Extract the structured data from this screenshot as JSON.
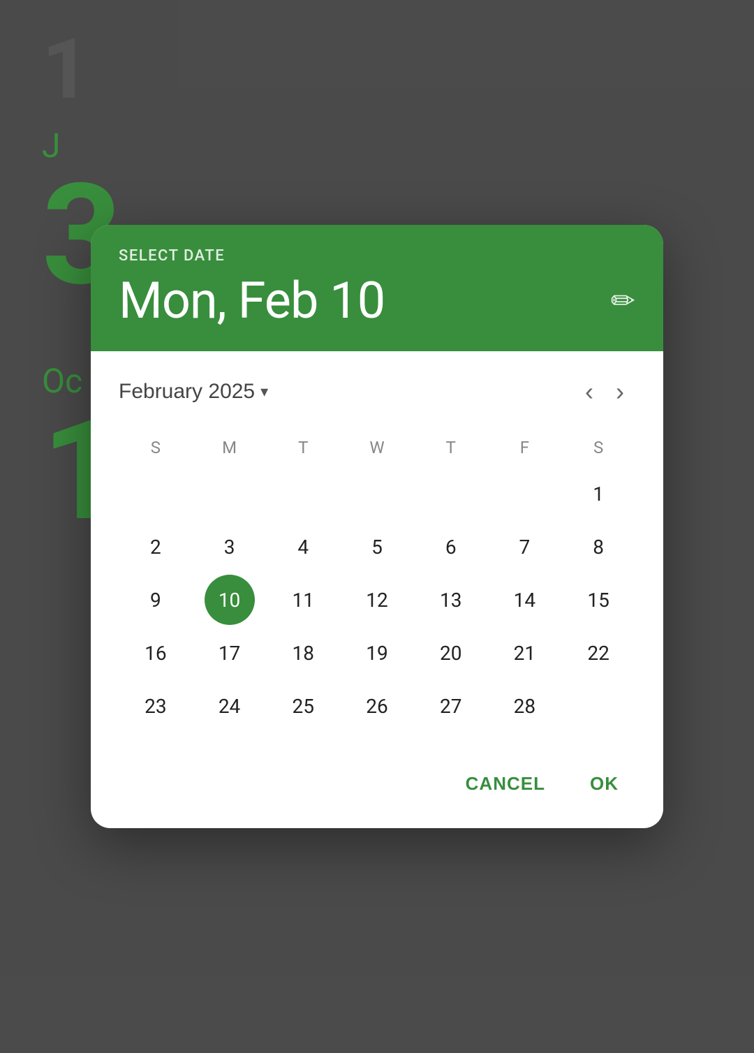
{
  "backdrop": true,
  "background": {
    "top_number": "1",
    "month1": "J",
    "day1": "3",
    "month2": "Oc",
    "day2": "1"
  },
  "dialog": {
    "header": {
      "select_date_label": "SELECT DATE",
      "selected_date": "Mon, Feb 10",
      "edit_icon_symbol": "✏"
    },
    "calendar": {
      "month_year": "February 2025",
      "dropdown_symbol": "▾",
      "prev_symbol": "‹",
      "next_symbol": "›",
      "days_of_week": [
        "S",
        "M",
        "T",
        "W",
        "T",
        "F",
        "S"
      ],
      "weeks": [
        [
          "",
          "",
          "",
          "",
          "",
          "",
          "1"
        ],
        [
          "2",
          "3",
          "4",
          "5",
          "6",
          "7",
          "8"
        ],
        [
          "9",
          "10",
          "11",
          "12",
          "13",
          "14",
          "15"
        ],
        [
          "16",
          "17",
          "18",
          "19",
          "20",
          "21",
          "22"
        ],
        [
          "23",
          "24",
          "25",
          "26",
          "27",
          "28",
          ""
        ]
      ],
      "selected_day": "10"
    },
    "footer": {
      "cancel_label": "CANCEL",
      "ok_label": "OK"
    }
  },
  "colors": {
    "green": "#388e3c",
    "white": "#ffffff"
  }
}
